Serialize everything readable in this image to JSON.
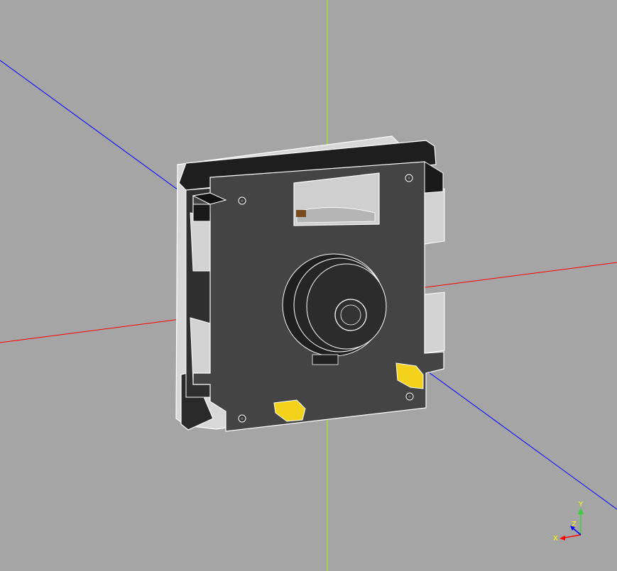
{
  "viewport": {
    "background": "#a5a5a5",
    "axis_colors": {
      "x": "#ff0000",
      "y": "#a0ff00",
      "z": "#0000ff"
    }
  },
  "model": {
    "body_color": "#444444",
    "edge_color": "#ffffff",
    "highlight_color": "#f2d21b",
    "transparent_color": "#d8d8d8"
  },
  "triad": {
    "x_label": "X",
    "y_label": "Y",
    "z_label": "Z"
  }
}
